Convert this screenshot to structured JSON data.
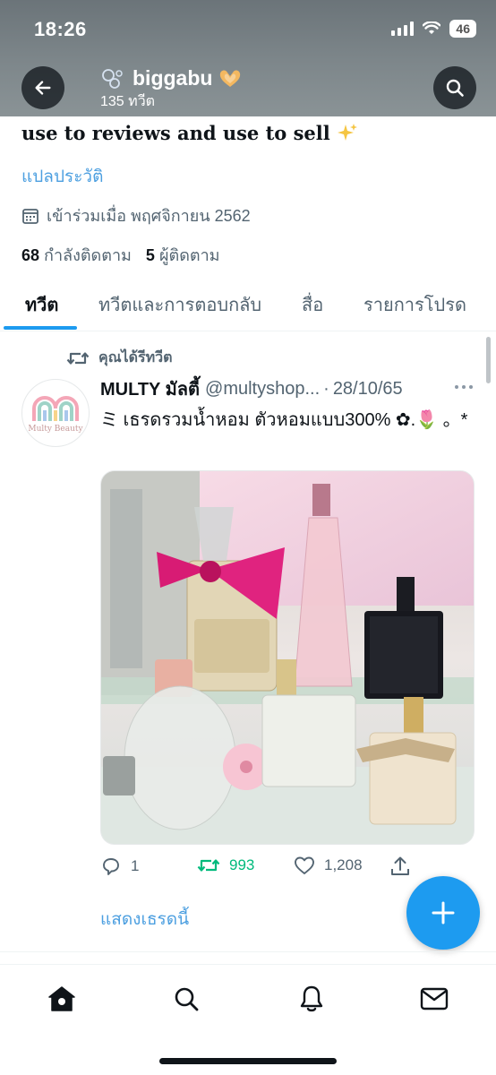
{
  "status_bar": {
    "time": "18:26",
    "battery": "46"
  },
  "header": {
    "name": "biggabu",
    "tweet_count": "135 ทวีต"
  },
  "profile": {
    "bio": "use to reviews and use to sell",
    "translate_label": "แปลประวัติ",
    "joined": "เข้าร่วมเมื่อ พฤศจิกายน 2562",
    "following_count": "68",
    "following_label": "กำลังติดตาม",
    "followers_count": "5",
    "followers_label": "ผู้ติดตาม"
  },
  "tabs": [
    {
      "label": "ทวีต"
    },
    {
      "label": "ทวีตและการตอบกลับ"
    },
    {
      "label": "สื่อ"
    },
    {
      "label": "รายการโปรด"
    }
  ],
  "tweet": {
    "retweet_label": "คุณได้รีทวีต",
    "avatar_caption": "Multy Beauty",
    "author": "MULTY มัลตี้",
    "handle": "@multyshop...",
    "separator": "·",
    "date": "28/10/65",
    "text": "ミ เธรดรวมน้ำหอม ตัวหอมแบบ300% ✿.🌷 。*",
    "replies": "1",
    "retweets": "993",
    "likes": "1,208",
    "show_thread": "แสดงเธรดนี้"
  },
  "colors": {
    "accent": "#1d9bf0",
    "link": "#4c9fe0",
    "retweet_green": "#00ba7c",
    "muted": "#536471"
  },
  "icons": [
    "back-arrow-icon",
    "search-icon",
    "calendar-icon",
    "retweet-icon",
    "more-icon",
    "reply-icon",
    "like-icon",
    "share-icon",
    "compose-plus-icon",
    "home-icon",
    "notifications-icon",
    "messages-icon"
  ]
}
